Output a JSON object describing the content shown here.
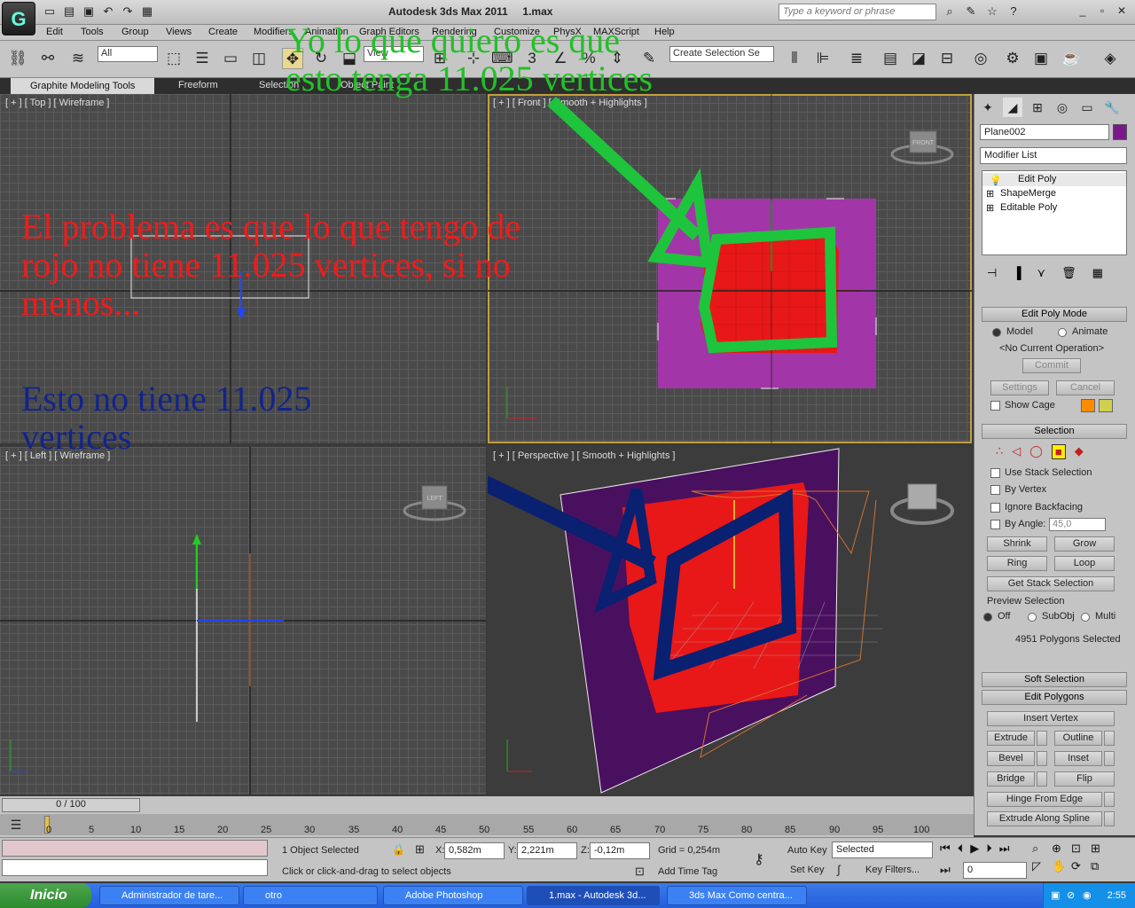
{
  "window": {
    "app_title": "Autodesk 3ds Max  2011",
    "file": "1.max",
    "search_placeholder": "Type a keyword or phrase"
  },
  "menu": [
    "Edit",
    "Tools",
    "Group",
    "Views",
    "Create",
    "Modifiers",
    "Animation",
    "Graph Editors",
    "Rendering",
    "Customize",
    "PhysX",
    "MAXScript",
    "Help"
  ],
  "toolbar": {
    "filter": "All",
    "view": "View",
    "named_selection": "Create Selection Se",
    "snap_value": "3"
  },
  "ribbon": {
    "tabs": [
      "Graphite Modeling Tools",
      "Freeform",
      "Selection",
      "Object Paint"
    ]
  },
  "viewports": {
    "top": "[ + ] [ Top ] [ Wireframe ]",
    "front": "[ + ] [ Front ] [ Smooth + Highlights ]",
    "left": "[ + ] [ Left ] [ Wireframe ]",
    "perspective": "[ + ] [ Perspective ] [ Smooth + Highlights ]",
    "viewcube_labels": {
      "front": "FRONT",
      "left": "LEFT"
    }
  },
  "annotations": {
    "green": "Yo lo que quiero es que esto tenga 11.025 vertices",
    "red": "El problema es que lo que tengo de rojo no tiene 11.025 vertices, si no menos...",
    "blue": "Esto no tiene 11.025 vertices"
  },
  "command_panel": {
    "object_name": "Plane002",
    "object_color": "#7a1a8a",
    "modifier_list": "Modifier List",
    "stack": [
      "Edit Poly",
      "ShapeMerge",
      "Editable Poly"
    ],
    "edit_poly_mode": {
      "title": "Edit Poly Mode",
      "model": "Model",
      "animate": "Animate",
      "operation": "<No Current Operation>",
      "commit": "Commit",
      "settings": "Settings",
      "cancel": "Cancel",
      "show_cage": "Show Cage"
    },
    "selection": {
      "title": "Selection",
      "use_stack": "Use Stack Selection",
      "by_vertex": "By Vertex",
      "ignore_backfacing": "Ignore Backfacing",
      "by_angle": "By Angle:",
      "angle_value": "45,0",
      "shrink": "Shrink",
      "grow": "Grow",
      "ring": "Ring",
      "loop": "Loop",
      "get_stack": "Get Stack Selection",
      "preview": "Preview Selection",
      "off": "Off",
      "subobj": "SubObj",
      "multi": "Multi",
      "info": "4951 Polygons Selected"
    },
    "soft_selection": "Soft Selection",
    "edit_polygons": {
      "title": "Edit Polygons",
      "insert_vertex": "Insert Vertex",
      "extrude": "Extrude",
      "outline": "Outline",
      "bevel": "Bevel",
      "inset": "Inset",
      "bridge": "Bridge",
      "flip": "Flip",
      "hinge": "Hinge From Edge",
      "extrude_spline": "Extrude Along Spline"
    }
  },
  "timeline": {
    "slider": "0 / 100",
    "ticks": [
      "0",
      "5",
      "10",
      "15",
      "20",
      "25",
      "30",
      "35",
      "40",
      "45",
      "50",
      "55",
      "60",
      "65",
      "70",
      "75",
      "80",
      "85",
      "90",
      "95",
      "100"
    ]
  },
  "status": {
    "selected": "1 Object Selected",
    "prompt": "Click or click-and-drag to select objects",
    "x_label": "X:",
    "x": "0,582m",
    "y_label": "Y:",
    "y": "2,221m",
    "z_label": "Z:",
    "z": "-0,12m",
    "grid": "Grid = 0,254m",
    "add_time_tag": "Add Time Tag",
    "auto_key": "Auto Key",
    "set_key": "Set Key",
    "key_mode": "Selected",
    "key_filters": "Key Filters...",
    "frame": "0"
  },
  "taskbar": {
    "start": "Inicio",
    "tasks": [
      "Administrador de tare...",
      "otro",
      "Adobe Photoshop",
      "1.max - Autodesk 3d...",
      "3ds Max Como centra..."
    ],
    "clock": "2:55"
  }
}
